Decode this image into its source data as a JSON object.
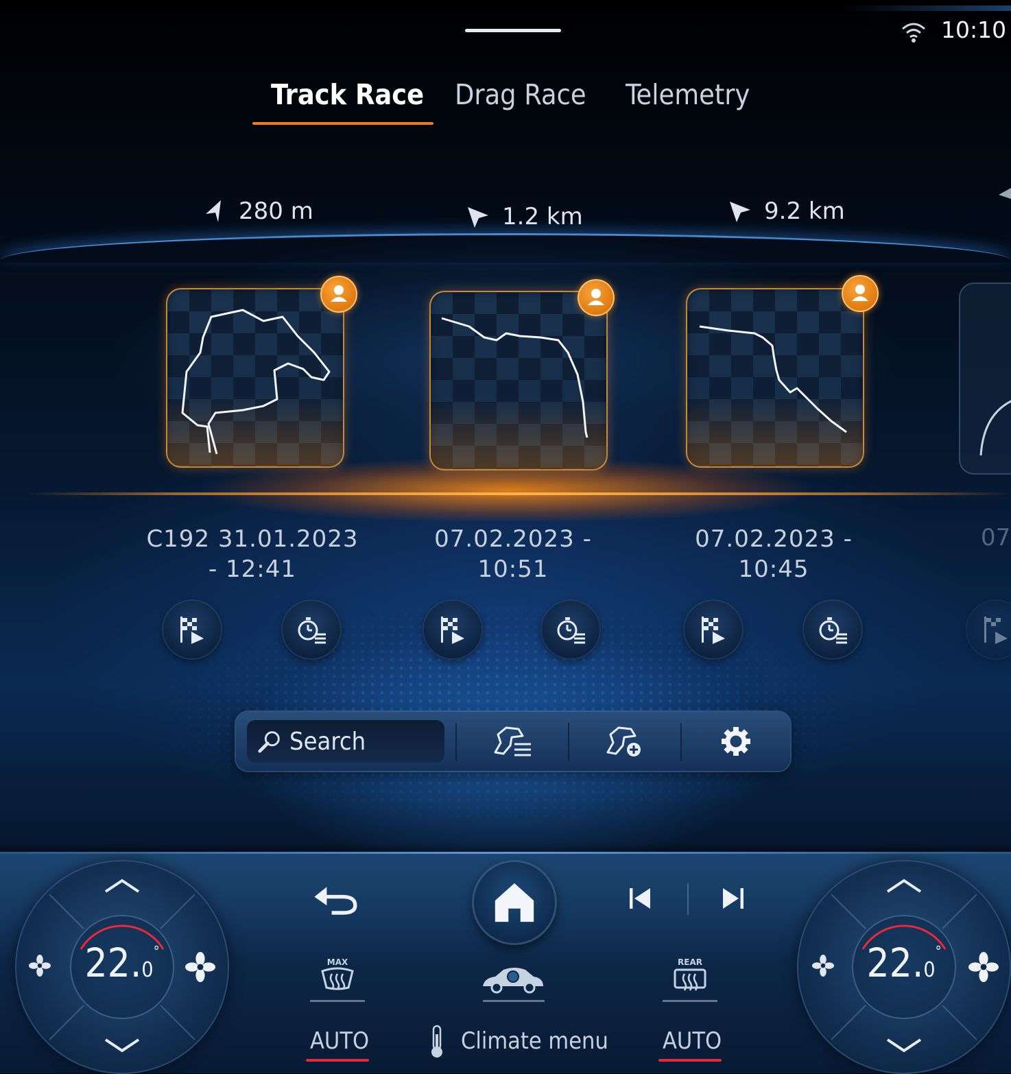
{
  "status_bar": {
    "time": "10:10"
  },
  "tabs": [
    {
      "label": "Track Race",
      "active": true
    },
    {
      "label": "Drag Race",
      "active": false
    },
    {
      "label": "Telemetry",
      "active": false
    }
  ],
  "tracks": [
    {
      "distance": "280 m",
      "caption_line1": "C192 31.01.2023",
      "caption_line2": "- 12:41"
    },
    {
      "distance": "1.2 km",
      "caption_line1": "07.02.2023 -",
      "caption_line2": "10:51"
    },
    {
      "distance": "9.2 km",
      "caption_line1": "07.02.2023 -",
      "caption_line2": "10:45"
    }
  ],
  "partial_next_caption": "07",
  "toolbar": {
    "search_label": "Search"
  },
  "climate": {
    "left_temp": "22.",
    "left_temp_decimal": "0",
    "left_temp_unit": "°",
    "right_temp": "22.",
    "right_temp_decimal": "0",
    "right_temp_unit": "°",
    "left_mode": "AUTO",
    "right_mode": "AUTO",
    "menu_label": "Climate menu",
    "max_defrost_label": "MAX",
    "rear_defrost_label": "REAR"
  },
  "colors": {
    "accent_orange": "#f07a1e",
    "badge_orange": "#e07a10",
    "active_red": "#e8283c",
    "panel_blue": "#143058"
  },
  "icons": {
    "wifi": "wifi-icon",
    "distance": "navigation-arrow-icon",
    "profile": "user-icon",
    "start_race": "checkered-flag-play-icon",
    "lap_times": "stopwatch-list-icon",
    "search": "magnifier-icon",
    "track_list": "track-list-icon",
    "add_track": "add-track-icon",
    "settings": "gear-icon",
    "back": "back-arrow-icon",
    "home": "home-icon",
    "previous": "skip-previous-icon",
    "next": "skip-next-icon",
    "fan": "fan-icon",
    "max_defrost": "windshield-defrost-icon",
    "rear_defrost": "rear-defrost-icon",
    "car": "car-airflow-icon",
    "thermometer": "thermometer-icon"
  }
}
